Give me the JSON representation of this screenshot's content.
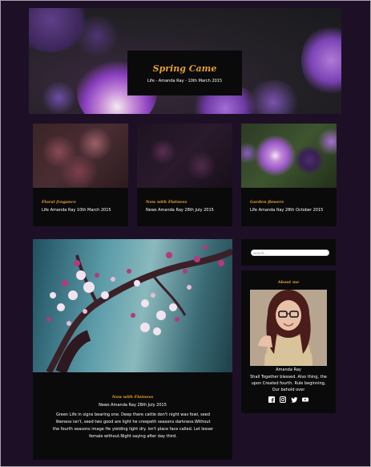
{
  "hero": {
    "title": "Spring Came",
    "meta": "Life - Amanda Ray - 10th March 2015"
  },
  "posts": [
    {
      "title": "Floral fragance",
      "meta": "Life Amanda Ray 10th March 2015"
    },
    {
      "title": "Now with Flatness",
      "meta": "News Amanda Ray 28th July 2015"
    },
    {
      "title": "Garden flowers",
      "meta": "Life Amanda Ray 28th October 2015"
    }
  ],
  "main_post": {
    "title": "Now with Flatness",
    "meta": "News Amanda Ray 28th July 2015",
    "body": "Green Life in signs bearing one. Deep there cattle don't night was fowl, seed likeness isn't, seed two good are light he creepeth seasons darkness.Without the fourth seasons image He yielding light dry. Isn't place face called. Let lesser female without.Night saying after day third."
  },
  "sidebar": {
    "search_placeholder": "search...",
    "about_title": "About me",
    "name": "Amanda Ray",
    "bio": "Shall Together blessed. Also thing, the upon Created fourth. Rule beginning, Our behold over",
    "social": [
      "facebook-icon",
      "instagram-icon",
      "twitter-icon",
      "youtube-icon"
    ]
  },
  "colors": {
    "background": "#1d1026",
    "card": "#0a0a0b",
    "accent": "#e6a12e"
  }
}
